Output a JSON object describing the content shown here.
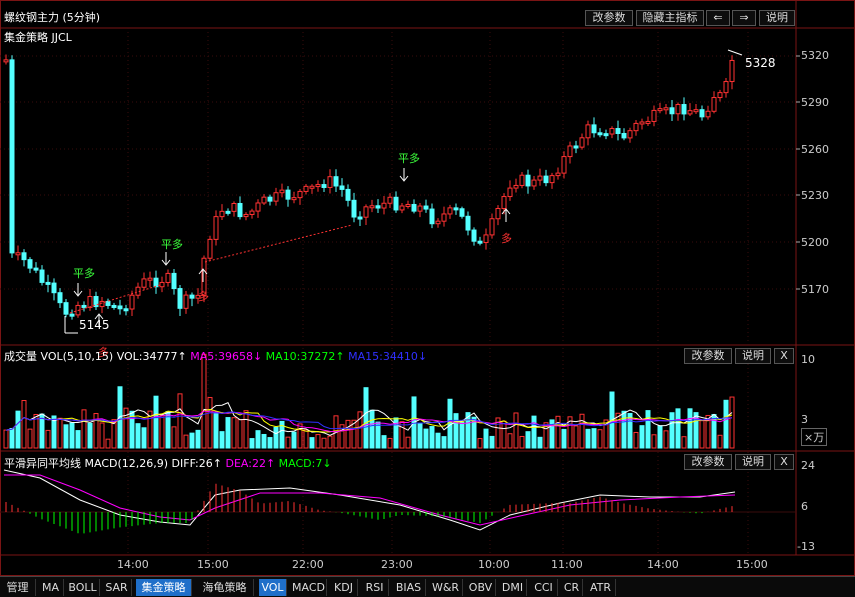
{
  "header": {
    "title": "螺纹钢主力 (5分钟)",
    "strategy": "集金策略 JJCL",
    "buttons": [
      "改参数",
      "隐藏主指标",
      "⇐",
      "⇒",
      "说明"
    ]
  },
  "price": {
    "ticks": [
      "5320",
      "5290",
      "5260",
      "5230",
      "5200",
      "5170"
    ],
    "last": "5328",
    "low_label": "5145",
    "signals": [
      "平多",
      "平多",
      "平多",
      "多",
      "多",
      "多"
    ]
  },
  "volume": {
    "label": "成交量",
    "params": "VOL(5,10,15)",
    "vol": "VOL:34777↑",
    "ma5": "MA5:39658↓",
    "ma10": "MA10:37272↑",
    "ma15": "MA15:34410↓",
    "buttons": [
      "改参数",
      "说明",
      "X"
    ],
    "ticks": [
      "10",
      "3"
    ],
    "unit": "×万"
  },
  "macd": {
    "label": "平滑异同平均线",
    "params": "MACD(12,26,9)",
    "diff": "DIFF:26↑",
    "dea": "DEA:22↑",
    "macd": "MACD:7↓",
    "buttons": [
      "改参数",
      "说明",
      "X"
    ],
    "ticks": [
      "24",
      "6",
      "-13"
    ]
  },
  "time_axis": [
    "14:00",
    "15:00",
    "22:00",
    "23:00",
    "10:00",
    "11:00",
    "14:00",
    "15:00"
  ],
  "tabs": [
    "管理",
    "MA",
    "BOLL",
    "SAR",
    "集金策略",
    "海龟策略",
    "VOL",
    "MACD",
    "KDJ",
    "RSI",
    "BIAS",
    "W&R",
    "OBV",
    "DMI",
    "CCI",
    "CR",
    "ATR"
  ],
  "colors": {
    "up": "#ff3232",
    "down": "#54ffff",
    "ma5": "#ff00ff",
    "ma10": "#00ff00",
    "ma15": "#3030ff",
    "accent": "#1f6fc9"
  }
}
